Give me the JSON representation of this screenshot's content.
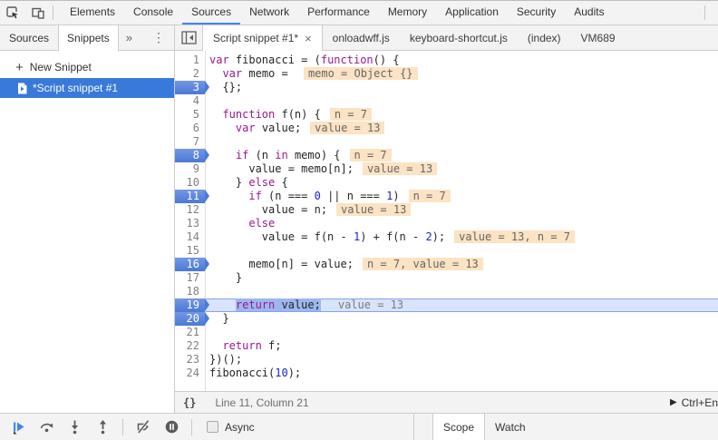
{
  "colors": {
    "accent": "#4285f4",
    "selection-blue": "#3879d9",
    "bp-top": "#7397e4",
    "bp-bottom": "#4b79d6",
    "exec-bg": "#d8e4fc",
    "exec-border": "#84a3e8",
    "token-hl": "#9db7ef",
    "ival-bg": "#fce3c3",
    "ival-text": "#666666",
    "kw": "#98188e",
    "num": "#1c22cf",
    "code-text": "#262626",
    "toolbar-bg": "#f3f3f3",
    "border": "#cccccc",
    "gutter-num": "#808080",
    "icon": "#5a5a5a"
  },
  "top_toolbar": {
    "tabs": [
      {
        "label": "Elements"
      },
      {
        "label": "Console"
      },
      {
        "label": "Sources",
        "selected": true
      },
      {
        "label": "Network"
      },
      {
        "label": "Performance"
      },
      {
        "label": "Memory"
      },
      {
        "label": "Application"
      },
      {
        "label": "Security"
      },
      {
        "label": "Audits"
      }
    ]
  },
  "sidebar": {
    "tabs": [
      {
        "label": "Sources"
      },
      {
        "label": "Snippets",
        "selected": true
      }
    ],
    "more_tabs_symbol": "»",
    "menu_symbol": "⋮",
    "new_snippet_plus": "+",
    "new_snippet_label": "New Snippet",
    "snippet_name": "*Script snippet #1"
  },
  "editor": {
    "tabs": [
      {
        "label": "Script snippet #1*",
        "selected": true,
        "close": "×"
      },
      {
        "label": "onloadwff.js"
      },
      {
        "label": "keyboard-shortcut.js"
      },
      {
        "label": "(index)"
      },
      {
        "label": "VM689"
      }
    ],
    "status": {
      "pretty_print": "{}",
      "position": "Line 11, Column 21",
      "run_glyph": "▶",
      "run_hint": "Ctrl+En"
    },
    "lines": [
      {
        "n": 1,
        "tokens": [
          {
            "t": "var",
            "c": "k"
          },
          {
            "t": " fibonacci = ("
          },
          {
            "t": "function",
            "c": "k"
          },
          {
            "t": "() {"
          }
        ]
      },
      {
        "n": 2,
        "tokens": [
          {
            "t": "  "
          },
          {
            "t": "var",
            "c": "k"
          },
          {
            "t": " memo = "
          }
        ],
        "badge": "memo = Object {}"
      },
      {
        "n": 3,
        "bp": true,
        "tokens": [
          {
            "t": "  {};"
          }
        ]
      },
      {
        "n": 4,
        "tokens": []
      },
      {
        "n": 5,
        "tokens": [
          {
            "t": "  "
          },
          {
            "t": "function",
            "c": "k"
          },
          {
            "t": " f(n) {"
          }
        ],
        "badge": "n = 7"
      },
      {
        "n": 6,
        "tokens": [
          {
            "t": "    "
          },
          {
            "t": "var",
            "c": "k"
          },
          {
            "t": " value;"
          }
        ],
        "badge": "value = 13"
      },
      {
        "n": 7,
        "tokens": []
      },
      {
        "n": 8,
        "bp": true,
        "tokens": [
          {
            "t": "    "
          },
          {
            "t": "if",
            "c": "k"
          },
          {
            "t": " (n "
          },
          {
            "t": "in",
            "c": "k"
          },
          {
            "t": " memo) {"
          }
        ],
        "badge": "n = 7"
      },
      {
        "n": 9,
        "tokens": [
          {
            "t": "      value = memo[n];"
          }
        ],
        "badge": "value = 13"
      },
      {
        "n": 10,
        "tokens": [
          {
            "t": "    } "
          },
          {
            "t": "else",
            "c": "k"
          },
          {
            "t": " {"
          }
        ]
      },
      {
        "n": 11,
        "bp": true,
        "tokens": [
          {
            "t": "      "
          },
          {
            "t": "if",
            "c": "k"
          },
          {
            "t": " (n === "
          },
          {
            "t": "0",
            "c": "n"
          },
          {
            "t": " || n === "
          },
          {
            "t": "1",
            "c": "n"
          },
          {
            "t": ")"
          }
        ],
        "badge": "n = 7"
      },
      {
        "n": 12,
        "tokens": [
          {
            "t": "        value = n;"
          }
        ],
        "badge": "value = 13"
      },
      {
        "n": 13,
        "tokens": [
          {
            "t": "      "
          },
          {
            "t": "else",
            "c": "k"
          }
        ]
      },
      {
        "n": 14,
        "tokens": [
          {
            "t": "        value = f(n - "
          },
          {
            "t": "1",
            "c": "n"
          },
          {
            "t": ") + f(n - "
          },
          {
            "t": "2",
            "c": "n"
          },
          {
            "t": ");"
          }
        ],
        "badge": "value = 13, n = 7"
      },
      {
        "n": 15,
        "tokens": []
      },
      {
        "n": 16,
        "bp": true,
        "tokens": [
          {
            "t": "      memo[n] = value;"
          }
        ],
        "badge": "n = 7, value = 13"
      },
      {
        "n": 17,
        "tokens": [
          {
            "t": "    }"
          }
        ]
      },
      {
        "n": 18,
        "tokens": []
      },
      {
        "n": 19,
        "bp": true,
        "exec": true,
        "tokens": [
          {
            "t": "    "
          },
          {
            "t": "return",
            "c": "k",
            "h": true
          },
          {
            "t": " value;",
            "h": true
          }
        ],
        "badge": "value = 13",
        "badge_plain": true
      },
      {
        "n": 20,
        "bp": true,
        "tokens": [
          {
            "t": "  }"
          }
        ]
      },
      {
        "n": 21,
        "tokens": []
      },
      {
        "n": 22,
        "tokens": [
          {
            "t": "  "
          },
          {
            "t": "return",
            "c": "k"
          },
          {
            "t": " f;"
          }
        ]
      },
      {
        "n": 23,
        "tokens": [
          {
            "t": "})();"
          }
        ]
      },
      {
        "n": 24,
        "tokens": [
          {
            "t": "fibonacci("
          },
          {
            "t": "10",
            "c": "n"
          },
          {
            "t": ");"
          }
        ]
      }
    ]
  },
  "debugger": {
    "async_label": "Async"
  },
  "side_panel": {
    "tabs": [
      {
        "label": "Scope",
        "selected": true
      },
      {
        "label": "Watch"
      }
    ]
  }
}
